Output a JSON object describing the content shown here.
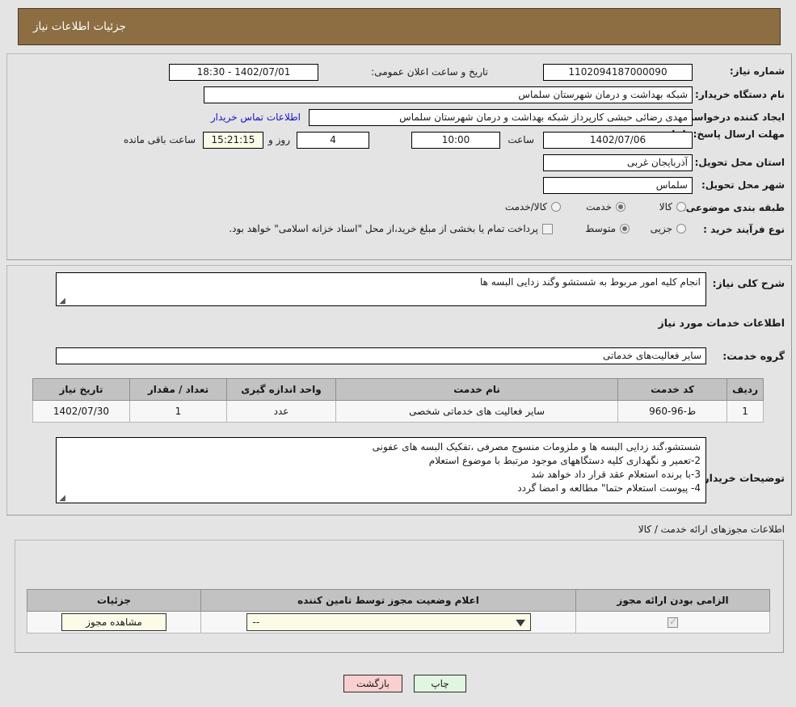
{
  "header": {
    "title": "جزئیات اطلاعات نیاز"
  },
  "info": {
    "need_number_label": "شماره نیاز:",
    "need_number_value": "1102094187000090",
    "announce_label": "تاریخ و ساعت اعلان عمومی:",
    "announce_value": "1402/07/01 - 18:30",
    "buyer_org_label": "نام دستگاه خریدار:",
    "buyer_org_value": "شبکه بهداشت و درمان  شهرستان سلماس",
    "creator_label": "ایجاد کننده درخواست:",
    "creator_value": "مهدی رضائی حبشی کارپرداز شبکه بهداشت و درمان  شهرستان سلماس",
    "contact_link": "اطلاعات تماس خریدار",
    "deadline_label": "مهلت ارسال پاسخ: تا تاریخ:",
    "deadline_date": "1402/07/06",
    "hour_label": "ساعت",
    "deadline_time": "10:00",
    "days_value": "4",
    "days_label": "روز و",
    "timer_value": "15:21:15",
    "timer_label": "ساعت باقی مانده",
    "province_label": "استان محل تحویل:",
    "province_value": "آذربایجان غربی",
    "city_label": "شهر محل تحویل:",
    "city_value": "سلماس",
    "category_label": "طبقه بندی موضوعی:",
    "category_options": [
      "کالا",
      "خدمت",
      "کالا/خدمت"
    ],
    "category_selected": "خدمت",
    "process_label": "نوع فرآیند خرید :",
    "process_options": [
      "جزیی",
      "متوسط"
    ],
    "process_selected": "متوسط",
    "treasury_checkbox_checked": false,
    "treasury_text": "پرداخت تمام یا بخشی از مبلغ خرید،از محل \"اسناد خزانه اسلامی\" خواهد بود."
  },
  "need": {
    "summary_label": "شرح کلی نیاز:",
    "summary_value": "انجام کلیه امور مربوط به شستشو وگند زدایی البسه ها",
    "services_heading": "اطلاعات خدمات مورد نیاز",
    "group_label": "گروه خدمت:",
    "group_value": "سایر فعالیت‌های خدماتی",
    "table": {
      "columns": [
        "ردیف",
        "کد خدمت",
        "نام خدمت",
        "واحد اندازه گیری",
        "تعداد / مقدار",
        "تاریخ نیاز"
      ],
      "rows": [
        {
          "row_no": "1",
          "service_code": "ط-96-960",
          "service_name": "سایر فعالیت های خدماتی شخصی",
          "unit": "عدد",
          "quantity": "1",
          "need_date": "1402/07/30"
        }
      ]
    },
    "notes_label": "توضیحات خریدار:",
    "notes_lines": [
      "شستشو،گند زدایی البسه ها و ملزومات منسوج مصرفی ،تفکیک البسه های عفونی",
      "2-تعمیر و نگهداری کلیه دستگاههای موجود  مرتبط با موضوع استعلام",
      "3-با برنده استعلام عقد قرار داد خواهد شد",
      "4- پیوست استعلام حتما\" مطالعه و امضا گردد"
    ]
  },
  "permits": {
    "section_label": "اطلاعات مجوزهای ارائه خدمت / کالا",
    "columns": [
      "الزامی بودن ارائه مجوز",
      "اعلام وضعیت مجوز توسط تامین کننده",
      "جزئیات"
    ],
    "rows": [
      {
        "required_checked": true,
        "status_value": "--",
        "details_button": "مشاهده مجوز"
      }
    ]
  },
  "footer": {
    "back_button": "بازگشت",
    "print_button": "چاپ"
  }
}
